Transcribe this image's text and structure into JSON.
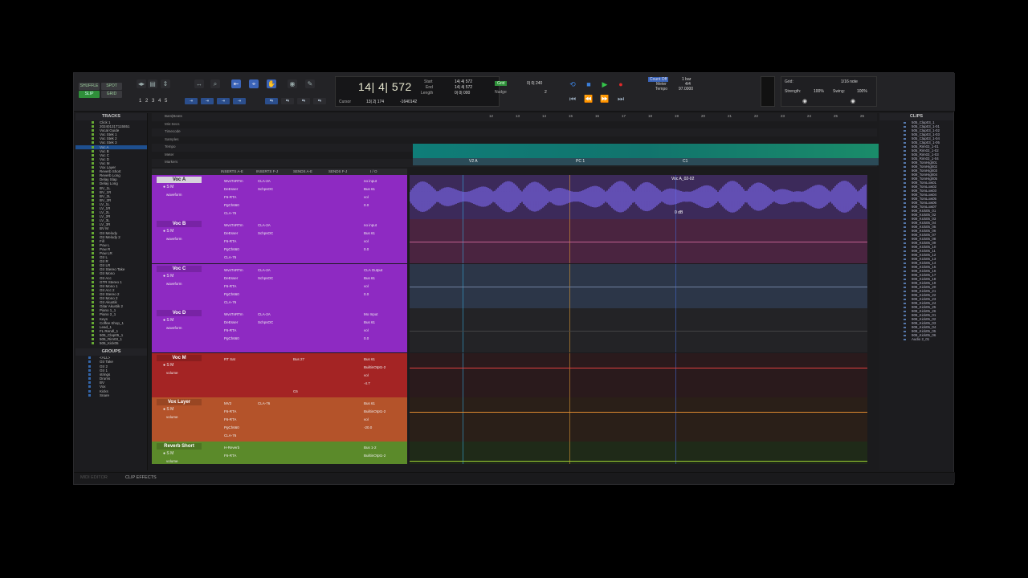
{
  "toolbar": {
    "modes": [
      "SHUFFLE",
      "SPOT",
      "SLIP",
      "GRID"
    ],
    "zoom_presets": [
      "1",
      "2",
      "3",
      "4",
      "5"
    ],
    "counter": {
      "main": "14| 4| 572",
      "start_label": "Start",
      "end_label": "End",
      "length_label": "Length",
      "start": "14| 4| 572",
      "end": "14| 4| 572",
      "length": "0| 0| 000",
      "cursor_label": "Cursor",
      "cursor": "13| 2| 174",
      "cursor_extra": "-1640142"
    },
    "nudge": {
      "grid_label": "Grid",
      "grid_value": "0| 0| 240",
      "nudge_label": "Nudge",
      "nudge_value": "2"
    },
    "count": {
      "count_off": "Count Off",
      "meter": "Meter",
      "tempo": "Tempo",
      "bar": "1 bar",
      "meter_value": "4/4",
      "tempo_value": "97.0000"
    },
    "grid_box": {
      "grid_label": "Grid:",
      "grid_value": "1/16 note",
      "strength_label": "Strength:",
      "strength_value": "100%",
      "swing_label": "Swing:",
      "swing_value": "100%"
    }
  },
  "tracks_panel": {
    "title": "TRACKS",
    "items": [
      "Click 1",
      "20240131T115551",
      "Vocal Guide",
      "Voc Stek 1",
      "Voc Stek 2",
      "Voc Stek 3",
      "Voc A",
      "Voc B",
      "Voc C",
      "Voc D",
      "Voc M",
      "Vox Layer",
      "Reverb Short",
      "Reverb Long",
      "Delay Slap",
      "Delay Long",
      "BV_1L",
      "BV_1R",
      "BV_2L",
      "BV_2R",
      "LV_1L",
      "LV_1R",
      "LV_2L",
      "LV_2R",
      "LV_3L",
      "LV_3R",
      "BV M",
      "Gtr Melody",
      "Gtr Melody 2",
      "Fill",
      "Pow L",
      "Pow R",
      "Pow LR",
      "Gtr L",
      "Gtr R",
      "Gtr LR",
      "Gtr Stereo Take",
      "Gtr Mono",
      "Gtr Acc",
      "GTR Stereo 1",
      "Gtr Mono 1",
      "Gtr Acc 2",
      "Gtr Stereo 2",
      "Gtr Mono 2",
      "Gtr Akustik",
      "Gitar Akustik 2",
      "Piano 1_1",
      "Piano 2_1",
      "Keys",
      "Coffee Shop_1",
      "Lead_1",
      "FL Rendl_1",
      "505_Clap05_1",
      "505_Rim03_1",
      "505_Kick05"
    ],
    "highlight_index": 6
  },
  "groups_panel": {
    "title": "GROUPS",
    "items": [
      "<ALL>",
      "Gtr Take",
      "Gtr 2",
      "Gtr 1",
      "strings",
      "Drums",
      "BV",
      "Vox",
      "Kicks",
      "Snare"
    ]
  },
  "rulers": {
    "rows": [
      "Bars|Beats",
      "Min:Secs",
      "Timecode",
      "Samples",
      "Tempo",
      "Meter",
      "Markers"
    ],
    "bar_ticks": [
      "12",
      "13",
      "14",
      "15",
      "16",
      "17",
      "18",
      "19",
      "20",
      "21",
      "22",
      "23",
      "24",
      "25",
      "26",
      "27",
      "28"
    ],
    "markers": [
      "V2 A",
      "PC 1",
      "C1"
    ]
  },
  "columns": [
    "INSERTS A-E",
    "INSERTS F-J",
    "SENDS A-E",
    "SENDS F-J",
    "I / O"
  ],
  "tracks": [
    {
      "name": "Voc A",
      "view": "waveform",
      "ins": [
        "WvsTnRTm",
        "DeEsser",
        "F6-RTA",
        "PgCh660",
        "CLA-76"
      ],
      "ins2": [
        "CLA-2A",
        "SchpsOC"
      ],
      "io": [
        "no input",
        "Bus 61",
        "vol",
        "0.0"
      ],
      "color": "#8e2ac2",
      "clip": "Voc A_02-02",
      "gain": "0 dB"
    },
    {
      "name": "Voc B",
      "view": "waveform",
      "ins": [
        "WvsTnRTm",
        "DeEsser",
        "F6-RTA",
        "PgCh660",
        "CLA-76"
      ],
      "ins2": [
        "CLA-2A",
        "SchpsOC"
      ],
      "io": [
        "no input",
        "Bus 61",
        "vol",
        "0.0"
      ],
      "color": "#8e2ac2"
    },
    {
      "name": "Voc C",
      "view": "waveform",
      "ins": [
        "WvsTnRTm",
        "DeEsser",
        "F6-RTA",
        "PgCh660",
        "CLA-76"
      ],
      "ins2": [
        "CLA-2A",
        "SchpsOC"
      ],
      "io": [
        "CLA Output",
        "Bus 61",
        "vol",
        "0.0"
      ],
      "color": "#8e2ac2"
    },
    {
      "name": "Voc D",
      "view": "waveform",
      "ins": [
        "WvsTnRTm",
        "DeEsser",
        "F6-RTA",
        "PgCh660"
      ],
      "ins2": [
        "CLA-2A",
        "SchpsOC"
      ],
      "io": [
        "Mo Input",
        "Bus 61",
        "vol",
        "0.0"
      ],
      "color": "#8e2ac2"
    },
    {
      "name": "Voc M",
      "view": "volume",
      "ins": [
        "RT Sat"
      ],
      "ins2": [],
      "snd": [
        "Bus 27",
        "",
        "",
        "",
        "C6"
      ],
      "io": [
        "Bus 61",
        "BuiltinOtpt1-2",
        "vol",
        "-4.7"
      ],
      "color": "#a42424"
    },
    {
      "name": "Vox Layer",
      "view": "volume",
      "ins": [
        "MV2",
        "F6-RTA",
        "F6-RTA",
        "PgCh660",
        "CLA-76"
      ],
      "ins2": [
        "CLA-76"
      ],
      "io": [
        "Bus 61",
        "BuiltinOtpt1-2",
        "vol",
        "-20.0"
      ],
      "color": "#b4532a"
    },
    {
      "name": "Reverb Short",
      "view": "volume",
      "ins": [
        "H-Reverb",
        "F6-RTA"
      ],
      "ins2": [],
      "io": [
        "Bus 1-2",
        "BuiltinOtpt1-2"
      ],
      "color": "#5b8a2a"
    }
  ],
  "clips_panel": {
    "title": "CLIPS",
    "items": [
      "505_Clap03_1",
      "505_Clap03_1-01",
      "505_Clap03_1-02",
      "505_Clap03_1-03",
      "505_Clap03_1-04",
      "505_Clap03_1-05",
      "505_Rim03_1-01",
      "505_Rim03_1-02",
      "505_Rim03_1-03",
      "505_Rim03_1-04",
      "909_TomHigh01",
      "909_TomHigh02",
      "909_TomHigh03",
      "909_TomHigh04",
      "909_TomHigh05",
      "909_TomLow01",
      "909_TomLow02",
      "909_TomLow03",
      "909_TomLow04",
      "909_TomLow05",
      "909_TomLow06",
      "909_TomLow07",
      "909_Kick05_01",
      "909_Kick05_02",
      "909_Kick05_03",
      "909_Kick05_04",
      "909_Kick05_05",
      "909_Kick05_06",
      "909_Kick05_07",
      "909_Kick05_08",
      "909_Kick05_09",
      "909_Kick05_10",
      "909_Kick05_11",
      "909_Kick05_12",
      "909_Kick05_13",
      "909_Kick05_14",
      "909_Kick05_15",
      "909_Kick05_16",
      "909_Kick05_17",
      "909_Kick05_18",
      "909_Kick05_19",
      "909_Kick05_20",
      "909_Kick05_21",
      "909_Kick05_22",
      "909_Kick05_23",
      "909_Kick05_24",
      "909_Kick05_25",
      "909_Kick05_26",
      "909_Kick05_01",
      "909_Kick05_02",
      "909_Kick05_03",
      "909_Kick05_04",
      "909_Kick05_05",
      "909_Kick05_06",
      "Audio 2_01"
    ]
  },
  "bottom": {
    "midi": "MIDI EDITOR",
    "clip_effects": "CLIP EFFECTS"
  }
}
